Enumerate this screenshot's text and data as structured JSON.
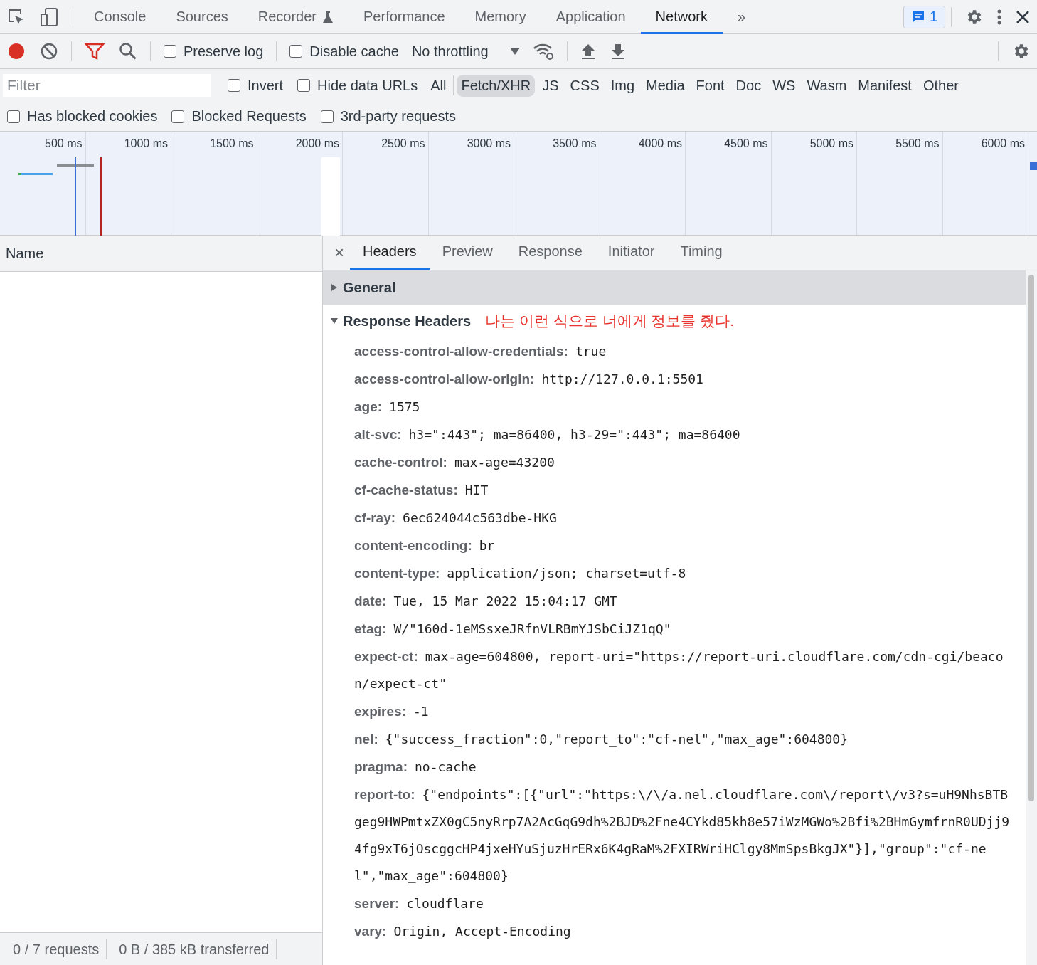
{
  "panel_tabs": [
    {
      "label": "Console",
      "selected": false,
      "experimental": false
    },
    {
      "label": "Sources",
      "selected": false,
      "experimental": false
    },
    {
      "label": "Recorder",
      "selected": false,
      "experimental": true
    },
    {
      "label": "Performance",
      "selected": false,
      "experimental": false
    },
    {
      "label": "Memory",
      "selected": false,
      "experimental": false
    },
    {
      "label": "Application",
      "selected": false,
      "experimental": false
    },
    {
      "label": "Network",
      "selected": true,
      "experimental": false
    }
  ],
  "more_tabs": "»",
  "messages_badge": "1",
  "toolbar": {
    "recording": true,
    "preserve_log": {
      "label": "Preserve log",
      "checked": false
    },
    "disable_cache": {
      "label": "Disable cache",
      "checked": false
    },
    "throttling": "No throttling"
  },
  "filter": {
    "placeholder": "Filter",
    "invert": {
      "label": "Invert",
      "checked": false
    },
    "hide_data_urls": {
      "label": "Hide data URLs",
      "checked": false
    },
    "types": [
      {
        "label": "All",
        "selected": false
      },
      {
        "label": "Fetch/XHR",
        "selected": true
      },
      {
        "label": "JS",
        "selected": false
      },
      {
        "label": "CSS",
        "selected": false
      },
      {
        "label": "Img",
        "selected": false
      },
      {
        "label": "Media",
        "selected": false
      },
      {
        "label": "Font",
        "selected": false
      },
      {
        "label": "Doc",
        "selected": false
      },
      {
        "label": "WS",
        "selected": false
      },
      {
        "label": "Wasm",
        "selected": false
      },
      {
        "label": "Manifest",
        "selected": false
      },
      {
        "label": "Other",
        "selected": false
      }
    ],
    "options": [
      {
        "label": "Has blocked cookies",
        "checked": false
      },
      {
        "label": "Blocked Requests",
        "checked": false
      },
      {
        "label": "3rd-party requests",
        "checked": false
      }
    ]
  },
  "timeline": {
    "ticks": [
      "500 ms",
      "1000 ms",
      "1500 ms",
      "2000 ms",
      "2500 ms",
      "3000 ms",
      "3500 ms",
      "4000 ms",
      "4500 ms",
      "5000 ms",
      "5500 ms",
      "6000 ms"
    ]
  },
  "requests": {
    "column": "Name",
    "status": [
      "0 / 7 requests",
      "0 B / 385 kB transferred"
    ]
  },
  "detail": {
    "close": "×",
    "tabs": [
      {
        "label": "Headers",
        "selected": true
      },
      {
        "label": "Preview",
        "selected": false
      },
      {
        "label": "Response",
        "selected": false
      },
      {
        "label": "Initiator",
        "selected": false
      },
      {
        "label": "Timing",
        "selected": false
      }
    ],
    "sections": [
      {
        "title": "General",
        "expanded": false
      },
      {
        "title": "Response Headers",
        "expanded": true,
        "note": "나는 이런 식으로 너에게 정보를 줬다.",
        "headers": [
          {
            "name": "access-control-allow-credentials:",
            "value": "true"
          },
          {
            "name": "access-control-allow-origin:",
            "value": "http://127.0.0.1:5501"
          },
          {
            "name": "age:",
            "value": "1575"
          },
          {
            "name": "alt-svc:",
            "value": "h3=\":443\"; ma=86400, h3-29=\":443\"; ma=86400"
          },
          {
            "name": "cache-control:",
            "value": "max-age=43200"
          },
          {
            "name": "cf-cache-status:",
            "value": "HIT"
          },
          {
            "name": "cf-ray:",
            "value": "6ec624044c563dbe-HKG"
          },
          {
            "name": "content-encoding:",
            "value": "br"
          },
          {
            "name": "content-type:",
            "value": "application/json; charset=utf-8"
          },
          {
            "name": "date:",
            "value": "Tue, 15 Mar 2022 15:04:17 GMT"
          },
          {
            "name": "etag:",
            "value": "W/\"160d-1eMSsxeJRfnVLRBmYJSbCiJZ1qQ\""
          },
          {
            "name": "expect-ct:",
            "value": "max-age=604800, report-uri=\"https://report-uri.cloudflare.com/cdn-cgi/beacon/expect-ct\""
          },
          {
            "name": "expires:",
            "value": "-1"
          },
          {
            "name": "nel:",
            "value": "{\"success_fraction\":0,\"report_to\":\"cf-nel\",\"max_age\":604800}"
          },
          {
            "name": "pragma:",
            "value": "no-cache"
          },
          {
            "name": "report-to:",
            "value": "{\"endpoints\":[{\"url\":\"https:\\/\\/a.nel.cloudflare.com\\/report\\/v3?s=uH9NhsBTBgeg9HWPmtxZX0gC5nyRrp7A2AcGqG9dh%2BJD%2Fne4CYkd85kh8e57iWzMGWo%2Bfi%2BHmGymfrnR0UDjj94fg9xT6jOscggcHP4jxeHYuSjuzHrERx6K4gRaM%2FXIRWriHClgy8MmSpsBkgJX\"}],\"group\":\"cf-nel\",\"max_age\":604800}"
          },
          {
            "name": "server:",
            "value": "cloudflare"
          },
          {
            "name": "vary:",
            "value": "Origin, Accept-Encoding"
          }
        ]
      }
    ]
  }
}
